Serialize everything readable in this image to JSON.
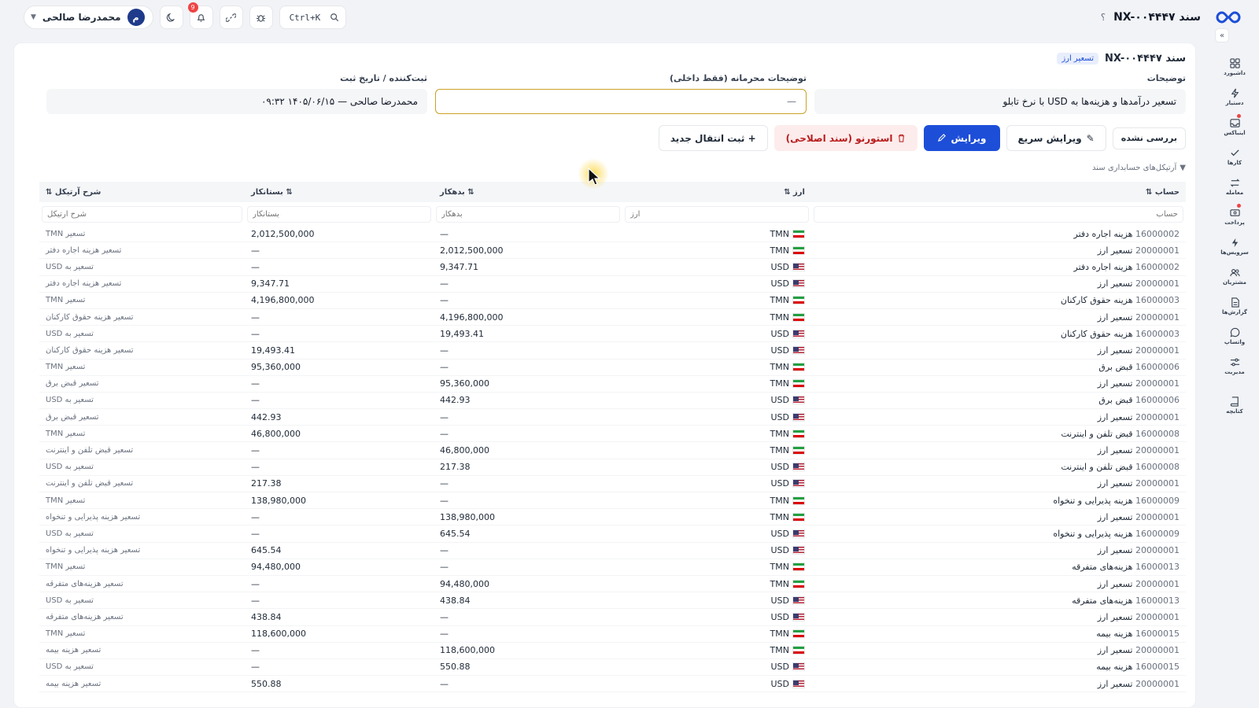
{
  "topbar": {
    "doc_title": "سند NX-۰۰۴۴۴۷",
    "help": "؟",
    "search_shortcut": "Ctrl+K",
    "notification_count": "9",
    "user_name": "محمدرضا صالحی",
    "user_initial": "م"
  },
  "sidebar": {
    "items": [
      {
        "label": "داشبورد",
        "icon": "grid-icon"
      },
      {
        "label": "دستیار",
        "icon": "bolt-icon"
      },
      {
        "label": "اینباکس",
        "icon": "inbox-icon"
      },
      {
        "label": "کارها",
        "icon": "check-icon"
      },
      {
        "label": "معامله",
        "icon": "swap-icon"
      },
      {
        "label": "پرداخت",
        "icon": "wallet-icon"
      },
      {
        "label": "سرویس‌ها",
        "icon": "lightning-icon"
      },
      {
        "label": "مشتریان",
        "icon": "users-icon"
      },
      {
        "label": "گزارش‌ها",
        "icon": "report-icon"
      },
      {
        "label": "واتساپ",
        "icon": "chat-icon"
      },
      {
        "label": "مدیریت",
        "icon": "sliders-icon"
      },
      {
        "label": "کتابچه",
        "icon": "book-icon"
      }
    ]
  },
  "card": {
    "title": "سند NX-۰۰۴۴۴۷",
    "tag": "تسعیر ارز",
    "description_label": "توضیحات",
    "description_value": "تسعیر درآمدها و هزینه‌ها به USD با نرخ تابلو",
    "private_label": "توضیحات محرمانه (فقط داخلی)",
    "private_value": "—",
    "registrar_label": "ثبت‌کننده / تاریخ ثبت",
    "registrar_value": "محمدرضا صالحی — ۱۴۰۵/۰۶/۱۵ ۰۹:۳۲"
  },
  "actions": {
    "status": "بررسی نشده",
    "quick_edit": "ویرایش سریع",
    "edit": "ویرایش",
    "reverse": "استورنو (سند اصلاحی)",
    "new_transfer": "+ ثبت انتقال جدید"
  },
  "section_title": "آرتیکل‌های حسابداری سند",
  "table": {
    "headers": {
      "account": "حساب ⇅",
      "currency": "ارز ⇅",
      "debit": "⇅ بدهکار",
      "credit": "⇅ بستانکار",
      "desc": "شرح آرتیکل ⇅"
    },
    "filters": {
      "account": "حساب",
      "currency": "ارز",
      "debit": "بدهکار",
      "credit": "بستانکار",
      "desc": "شرح آرتیکل"
    },
    "rows": [
      {
        "code": "16000002",
        "name": "هزینه اجاره دفتر",
        "cur": "TMN",
        "debit": "—",
        "credit": "2,012,500,000",
        "desc": "تسعیر TMN"
      },
      {
        "code": "20000001",
        "name": "تسعیر ارز",
        "cur": "TMN",
        "debit": "2,012,500,000",
        "credit": "—",
        "desc": "تسعیر هزینه اجاره دفتر"
      },
      {
        "code": "16000002",
        "name": "هزینه اجاره دفتر",
        "cur": "USD",
        "debit": "9,347.71",
        "credit": "—",
        "desc": "تسعیر به USD"
      },
      {
        "code": "20000001",
        "name": "تسعیر ارز",
        "cur": "USD",
        "debit": "—",
        "credit": "9,347.71",
        "desc": "تسعیر هزینه اجاره دفتر"
      },
      {
        "code": "16000003",
        "name": "هزینه حقوق کارکنان",
        "cur": "TMN",
        "debit": "—",
        "credit": "4,196,800,000",
        "desc": "تسعیر TMN"
      },
      {
        "code": "20000001",
        "name": "تسعیر ارز",
        "cur": "TMN",
        "debit": "4,196,800,000",
        "credit": "—",
        "desc": "تسعیر هزینه حقوق کارکنان"
      },
      {
        "code": "16000003",
        "name": "هزینه حقوق کارکنان",
        "cur": "USD",
        "debit": "19,493.41",
        "credit": "—",
        "desc": "تسعیر به USD"
      },
      {
        "code": "20000001",
        "name": "تسعیر ارز",
        "cur": "USD",
        "debit": "—",
        "credit": "19,493.41",
        "desc": "تسعیر هزینه حقوق کارکنان"
      },
      {
        "code": "16000006",
        "name": "قبض برق",
        "cur": "TMN",
        "debit": "—",
        "credit": "95,360,000",
        "desc": "تسعیر TMN"
      },
      {
        "code": "20000001",
        "name": "تسعیر ارز",
        "cur": "TMN",
        "debit": "95,360,000",
        "credit": "—",
        "desc": "تسعیر قبض برق"
      },
      {
        "code": "16000006",
        "name": "قبض برق",
        "cur": "USD",
        "debit": "442.93",
        "credit": "—",
        "desc": "تسعیر به USD"
      },
      {
        "code": "20000001",
        "name": "تسعیر ارز",
        "cur": "USD",
        "debit": "—",
        "credit": "442.93",
        "desc": "تسعیر قبض برق"
      },
      {
        "code": "16000008",
        "name": "قبض تلفن و اینترنت",
        "cur": "TMN",
        "debit": "—",
        "credit": "46,800,000",
        "desc": "تسعیر TMN"
      },
      {
        "code": "20000001",
        "name": "تسعیر ارز",
        "cur": "TMN",
        "debit": "46,800,000",
        "credit": "—",
        "desc": "تسعیر قبض تلفن و اینترنت"
      },
      {
        "code": "16000008",
        "name": "قبض تلفن و اینترنت",
        "cur": "USD",
        "debit": "217.38",
        "credit": "—",
        "desc": "تسعیر به USD"
      },
      {
        "code": "20000001",
        "name": "تسعیر ارز",
        "cur": "USD",
        "debit": "—",
        "credit": "217.38",
        "desc": "تسعیر قبض تلفن و اینترنت"
      },
      {
        "code": "16000009",
        "name": "هزینه پذیرایی و تنخواه",
        "cur": "TMN",
        "debit": "—",
        "credit": "138,980,000",
        "desc": "تسعیر TMN"
      },
      {
        "code": "20000001",
        "name": "تسعیر ارز",
        "cur": "TMN",
        "debit": "138,980,000",
        "credit": "—",
        "desc": "تسعیر هزینه پذیرایی و تنخواه"
      },
      {
        "code": "16000009",
        "name": "هزینه پذیرایی و تنخواه",
        "cur": "USD",
        "debit": "645.54",
        "credit": "—",
        "desc": "تسعیر به USD"
      },
      {
        "code": "20000001",
        "name": "تسعیر ارز",
        "cur": "USD",
        "debit": "—",
        "credit": "645.54",
        "desc": "تسعیر هزینه پذیرایی و تنخواه"
      },
      {
        "code": "16000013",
        "name": "هزینه‌های متفرقه",
        "cur": "TMN",
        "debit": "—",
        "credit": "94,480,000",
        "desc": "تسعیر TMN"
      },
      {
        "code": "20000001",
        "name": "تسعیر ارز",
        "cur": "TMN",
        "debit": "94,480,000",
        "credit": "—",
        "desc": "تسعیر هزینه‌های متفرقه"
      },
      {
        "code": "16000013",
        "name": "هزینه‌های متفرقه",
        "cur": "USD",
        "debit": "438.84",
        "credit": "—",
        "desc": "تسعیر به USD"
      },
      {
        "code": "20000001",
        "name": "تسعیر ارز",
        "cur": "USD",
        "debit": "—",
        "credit": "438.84",
        "desc": "تسعیر هزینه‌های متفرقه"
      },
      {
        "code": "16000015",
        "name": "هزینه بیمه",
        "cur": "TMN",
        "debit": "—",
        "credit": "118,600,000",
        "desc": "تسعیر TMN"
      },
      {
        "code": "20000001",
        "name": "تسعیر ارز",
        "cur": "TMN",
        "debit": "118,600,000",
        "credit": "—",
        "desc": "تسعیر هزینه بیمه"
      },
      {
        "code": "16000015",
        "name": "هزینه بیمه",
        "cur": "USD",
        "debit": "550.88",
        "credit": "—",
        "desc": "تسعیر به USD"
      },
      {
        "code": "20000001",
        "name": "تسعیر ارز",
        "cur": "USD",
        "debit": "—",
        "credit": "550.88",
        "desc": "تسعیر هزینه بیمه"
      }
    ]
  }
}
